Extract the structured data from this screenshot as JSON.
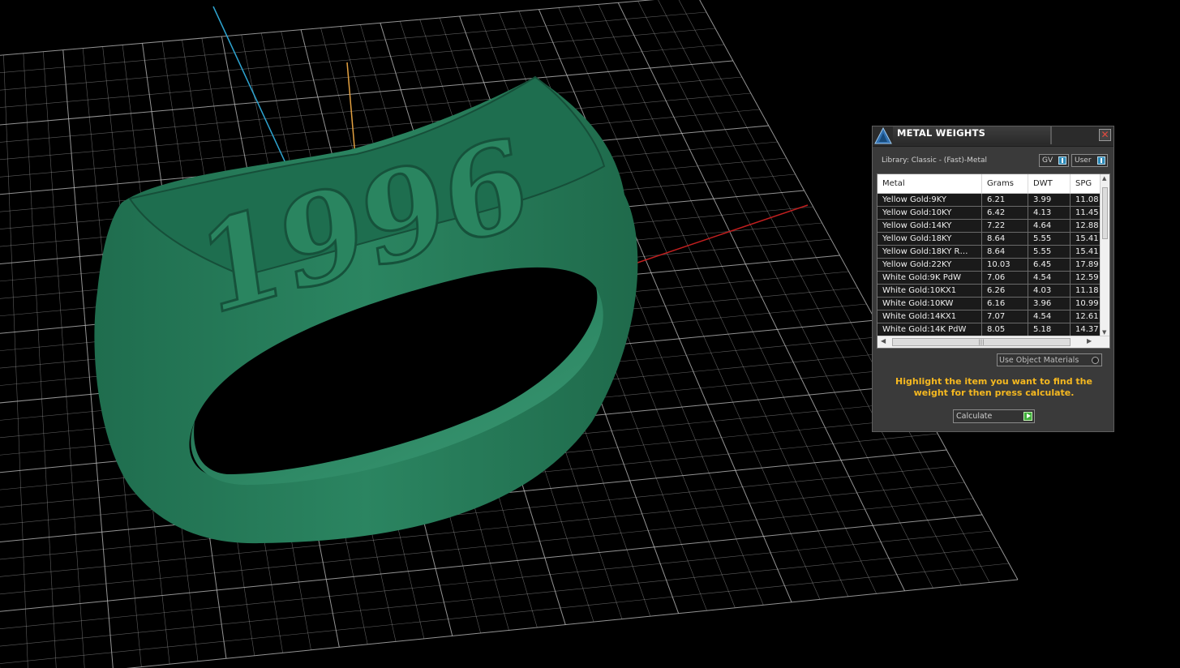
{
  "viewport": {
    "background": "#000000",
    "grid_color": "#b8b8b8",
    "axis_colors": {
      "x": "#c21f1f",
      "y": "#2ea4d0",
      "z": "#e2a040"
    },
    "model": {
      "type": "signet ring",
      "color": "#24795a",
      "engraving": "1996"
    }
  },
  "panel": {
    "title": "METAL WEIGHTS",
    "close_icon": "✕",
    "library": "Library: Classic - (Fast)-Metal",
    "toggle_gv": "GV",
    "toggle_user": "User",
    "table": {
      "columns": [
        "Metal",
        "Grams",
        "DWT",
        "SPG"
      ],
      "rows": [
        [
          "Yellow Gold:9KY",
          "6.21",
          "3.99",
          "11.08"
        ],
        [
          "Yellow Gold:10KY",
          "6.42",
          "4.13",
          "11.45"
        ],
        [
          "Yellow Gold:14KY",
          "7.22",
          "4.64",
          "12.88"
        ],
        [
          "Yellow Gold:18KY",
          "8.64",
          "5.55",
          "15.41"
        ],
        [
          "Yellow Gold:18KY R…",
          "8.64",
          "5.55",
          "15.41"
        ],
        [
          "Yellow Gold:22KY",
          "10.03",
          "6.45",
          "17.89"
        ],
        [
          "White Gold:9K PdW",
          "7.06",
          "4.54",
          "12.59"
        ],
        [
          "White Gold:10KX1",
          "6.26",
          "4.03",
          "11.18"
        ],
        [
          "White Gold:10KW",
          "6.16",
          "3.96",
          "10.99"
        ],
        [
          "White Gold:14KX1",
          "7.07",
          "4.54",
          "12.61"
        ],
        [
          "White Gold:14K PdW",
          "8.05",
          "5.18",
          "14.37"
        ]
      ]
    },
    "use_object_materials": "Use Object Materials",
    "hint": "Highlight the item you want to find the weight for then press calculate.",
    "calculate": "Calculate"
  }
}
